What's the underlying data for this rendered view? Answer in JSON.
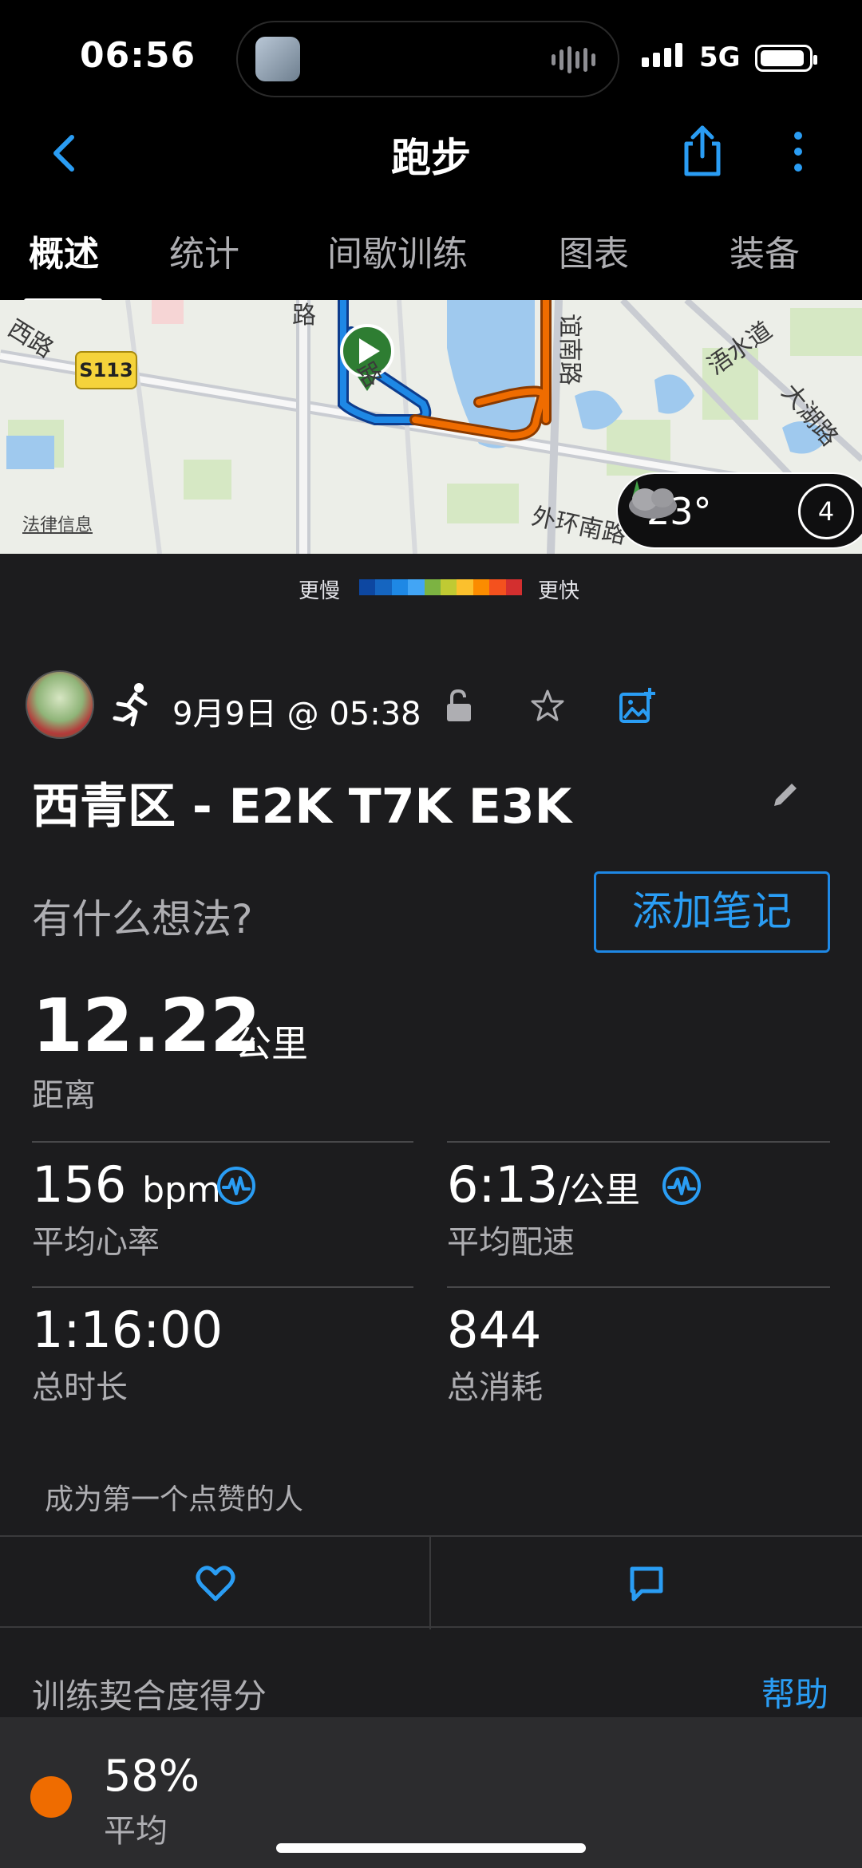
{
  "status_bar": {
    "time": "06:56",
    "network": "5G"
  },
  "header": {
    "title": "跑步"
  },
  "tabs": [
    {
      "label": "概述"
    },
    {
      "label": "统计"
    },
    {
      "label": "间歇训练"
    },
    {
      "label": "图表"
    },
    {
      "label": "装备"
    }
  ],
  "map": {
    "road_labels": [
      "西路",
      "路",
      "谊南路",
      "浯水道",
      "大湖路",
      "外环南路",
      "路"
    ],
    "route_badge": "S113",
    "legal_link": "法律信息",
    "weather": {
      "temperature": "23°",
      "wind_level": "4"
    }
  },
  "legend": {
    "slow": "更慢",
    "fast": "更快",
    "colors": [
      "#0d47a1",
      "#1565c0",
      "#1e88e5",
      "#42a5f5",
      "#7cb342",
      "#c0ca33",
      "#fbc02d",
      "#fb8c00",
      "#f4511e",
      "#d32f2f"
    ]
  },
  "activity": {
    "datetime": "9月9日 @ 05:38",
    "title": "西青区 - E2K T7K E3K",
    "note_prompt": "有什么想法?",
    "add_note_button": "添加笔记"
  },
  "stats": {
    "distance": {
      "value": "12.22",
      "unit": "公里",
      "label": "距离"
    },
    "avg_hr": {
      "value": "156",
      "unit": "bpm",
      "label": "平均心率"
    },
    "avg_pace": {
      "value": "6:13",
      "unit": "/公里",
      "label": "平均配速"
    },
    "duration": {
      "value": "1:16:00",
      "label": "总时长"
    },
    "calories": {
      "value": "844",
      "label": "总消耗"
    }
  },
  "social": {
    "likes_text": "成为第一个点赞的人"
  },
  "training_fit": {
    "title": "训练契合度得分",
    "help": "帮助",
    "value": "58%",
    "label": "平均"
  },
  "colors": {
    "accent": "#2a9df4",
    "background": "#1c1c1e",
    "route_blue": "#1e88e5",
    "route_orange": "#ef6c00"
  }
}
